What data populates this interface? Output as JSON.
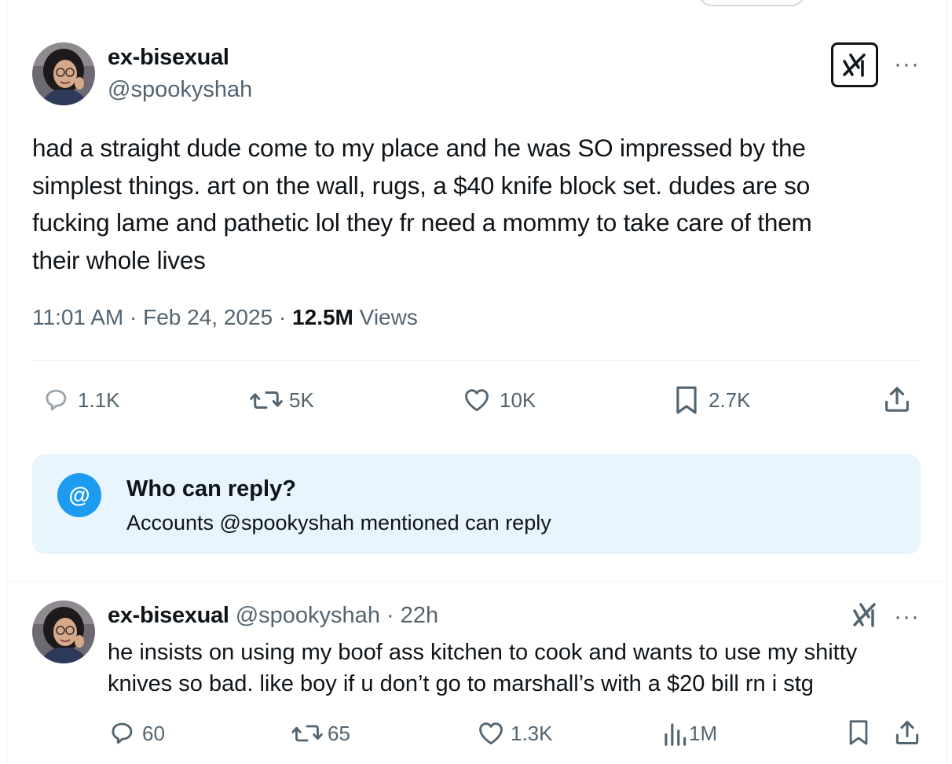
{
  "main_tweet": {
    "author": {
      "display_name": "ex-bisexual",
      "handle": "@spookyshah"
    },
    "text": "had a straight dude come to my place and he was SO impressed by the\nsimplest things. art on the wall, rugs, a $40 knife block set. dudes are so\nfucking lame and pathetic lol they fr need a mommy to take care of them\ntheir whole lives",
    "time": "11:01 AM",
    "separator": "·",
    "date": "Feb 24, 2025",
    "views_count": "12.5M",
    "views_label": "Views",
    "actions": {
      "replies": "1.1K",
      "reposts": "5K",
      "likes": "10K",
      "bookmarks": "2.7K"
    },
    "reply_restriction": {
      "icon_text": "@",
      "title": "Who can reply?",
      "description": "Accounts @spookyshah mentioned can reply"
    }
  },
  "reply_tweet": {
    "author": {
      "display_name": "ex-bisexual",
      "handle": "@spookyshah"
    },
    "separator": "·",
    "relative_time": "22h",
    "text": "he insists on using my boof ass kitchen to cook and wants to use my shitty\nknives so bad. like boy if u don’t go to marshall’s with a $20 bill rn i stg",
    "actions": {
      "replies": "60",
      "reposts": "65",
      "likes": "1.3K",
      "views": "1M"
    }
  },
  "more_options_text": "···",
  "colors": {
    "text_primary": "#0f1419",
    "text_secondary": "#536471",
    "accent_blue": "#1d9bf0",
    "reply_box_bg": "#e8f5fd",
    "divider": "#eff3f4"
  },
  "icons": [
    "grok-icon",
    "more-options-icon",
    "reply-icon",
    "repost-icon",
    "like-icon",
    "bookmark-icon",
    "share-icon",
    "views-icon",
    "mention-icon"
  ]
}
